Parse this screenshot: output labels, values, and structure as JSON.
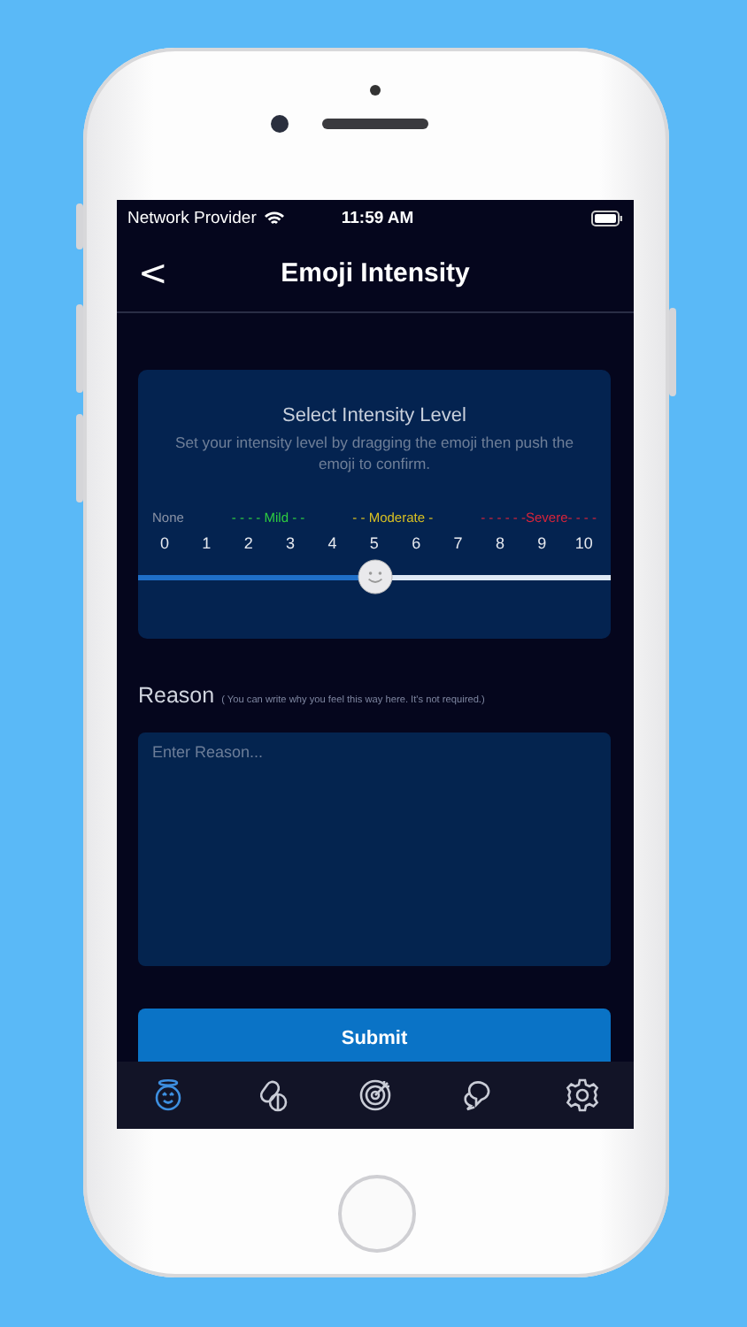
{
  "status_bar": {
    "carrier": "Network Provider",
    "time": "11:59 AM"
  },
  "nav": {
    "back": "<",
    "title": "Emoji Intensity"
  },
  "intensity_card": {
    "title": "Select Intensity Level",
    "subtitle": "Set your intensity level by dragging the emoji then push the emoji to confirm.",
    "scale_labels": [
      {
        "text": "None",
        "color": "#8a93a6"
      },
      {
        "text": "- - - - Mild - -",
        "color": "#2ecc40"
      },
      {
        "text": "- - Moderate -",
        "color": "#d9c022"
      },
      {
        "text": "- - - - - -Severe- - - -",
        "color": "#d8243a"
      }
    ],
    "numbers": [
      "0",
      "1",
      "2",
      "3",
      "4",
      "5",
      "6",
      "7",
      "8",
      "9",
      "10"
    ],
    "slider": {
      "level": 0.5
    }
  },
  "reason": {
    "label": "Reason",
    "hint": "( You can write why you feel this way here. It's not required.)",
    "placeholder": "Enter Reason..."
  },
  "submit": "Submit",
  "tabs": [
    {
      "selected": true
    },
    {
      "selected": false
    },
    {
      "selected": false
    },
    {
      "selected": false
    },
    {
      "selected": false
    }
  ]
}
